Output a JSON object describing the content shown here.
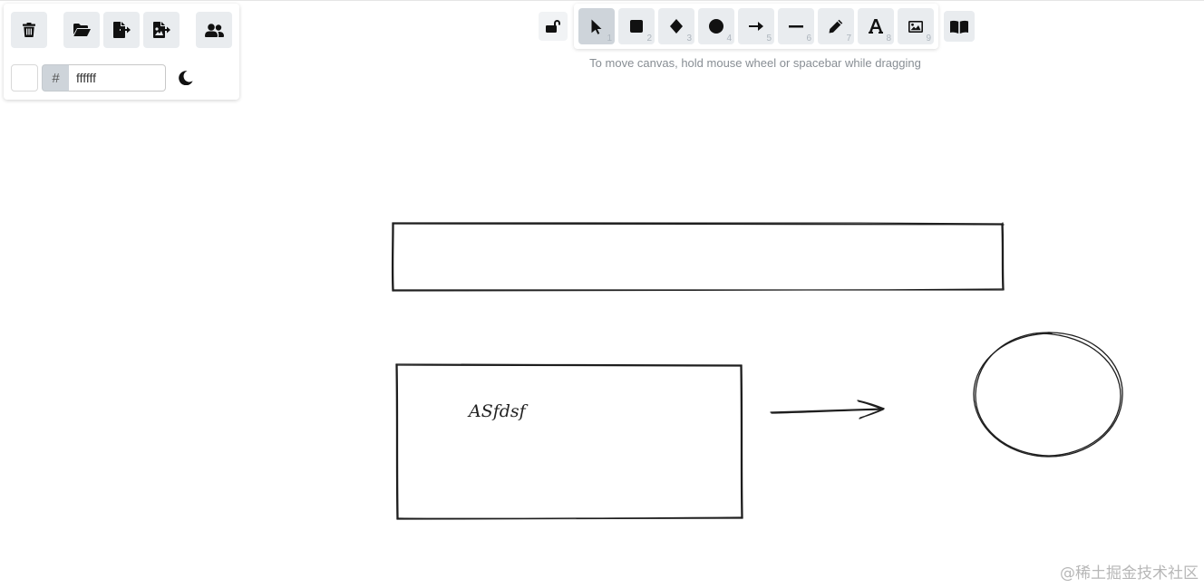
{
  "menu": {
    "buttons": [
      {
        "name": "clear-canvas-button",
        "icon": "trash-icon",
        "title": "Clear canvas"
      },
      {
        "name": "open-button",
        "icon": "folder-open-icon",
        "title": "Open"
      },
      {
        "name": "save-button",
        "icon": "file-export-icon",
        "title": "Save"
      },
      {
        "name": "export-button",
        "icon": "file-image-export-icon",
        "title": "Export"
      },
      {
        "name": "collaboration-button",
        "icon": "users-icon",
        "title": "Live collaboration"
      }
    ],
    "background_color": {
      "swatch": "#ffffff",
      "hash": "#",
      "value": "ffffff"
    },
    "theme_toggle_icon": "moon-icon"
  },
  "toolbar": {
    "lock_icon": "unlock-icon",
    "tools": [
      {
        "name": "selection",
        "icon": "cursor-icon",
        "key": "1",
        "selected": true
      },
      {
        "name": "rectangle",
        "icon": "square-icon",
        "key": "2"
      },
      {
        "name": "diamond",
        "icon": "diamond-icon",
        "key": "3"
      },
      {
        "name": "ellipse",
        "icon": "circle-icon",
        "key": "4"
      },
      {
        "name": "arrow",
        "icon": "arrow-right-icon",
        "key": "5"
      },
      {
        "name": "line",
        "icon": "line-icon",
        "key": "6"
      },
      {
        "name": "draw",
        "icon": "pencil-icon",
        "key": "7"
      },
      {
        "name": "text",
        "icon": "text-icon",
        "key": "8"
      },
      {
        "name": "image",
        "icon": "image-icon",
        "key": "9"
      }
    ],
    "library_icon": "book-open-icon",
    "hint": "To move canvas, hold mouse wheel or spacebar while dragging"
  },
  "canvas": {
    "elements": [
      {
        "type": "rectangle",
        "label": ""
      },
      {
        "type": "rectangle",
        "label": ""
      },
      {
        "type": "text",
        "text": "ASfdsf"
      },
      {
        "type": "arrow"
      },
      {
        "type": "ellipse"
      }
    ]
  },
  "watermark": "@稀土掘金技术社区",
  "colors": {
    "button_bg": "#e9ecef",
    "selected_bg": "#ced4da",
    "stroke": "#1e1e1e",
    "hint_text": "#888e94"
  }
}
